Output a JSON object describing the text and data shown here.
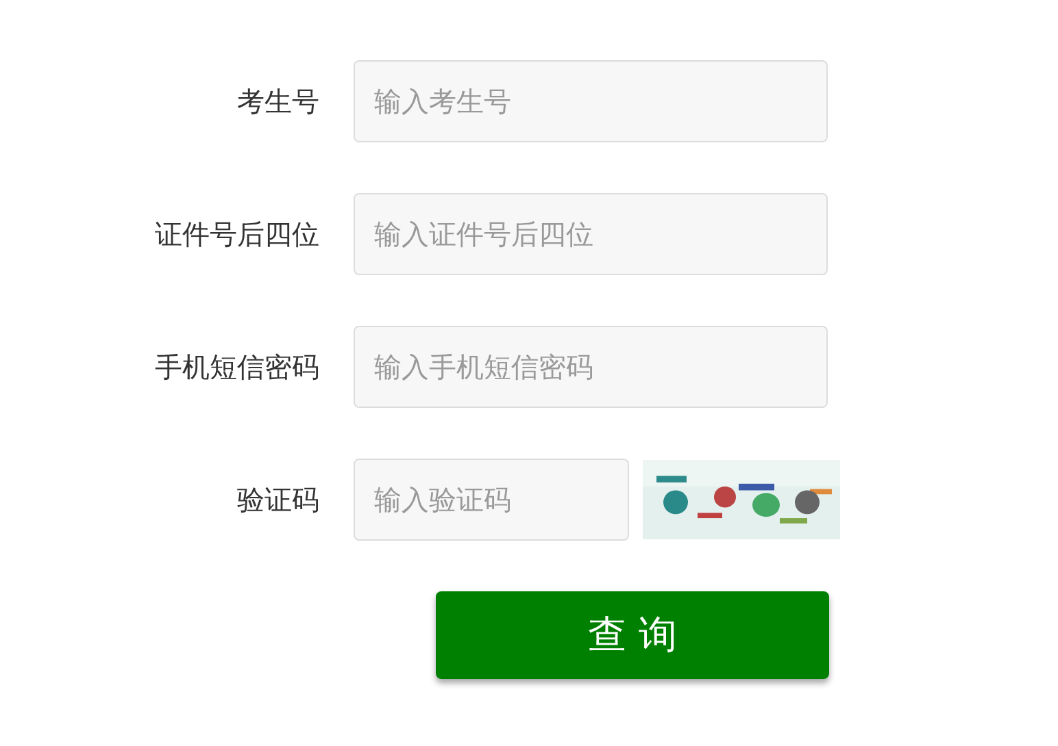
{
  "fields": [
    {
      "label": "考生号",
      "placeholder": "输入考生号",
      "kind": "text"
    },
    {
      "label": "证件号后四位",
      "placeholder": "输入证件号后四位",
      "kind": "text"
    },
    {
      "label": "手机短信密码",
      "placeholder": "输入手机短信密码",
      "kind": "text"
    },
    {
      "label": "验证码",
      "placeholder": "输入验证码",
      "kind": "captcha"
    }
  ],
  "submit": {
    "label": "查 询"
  }
}
